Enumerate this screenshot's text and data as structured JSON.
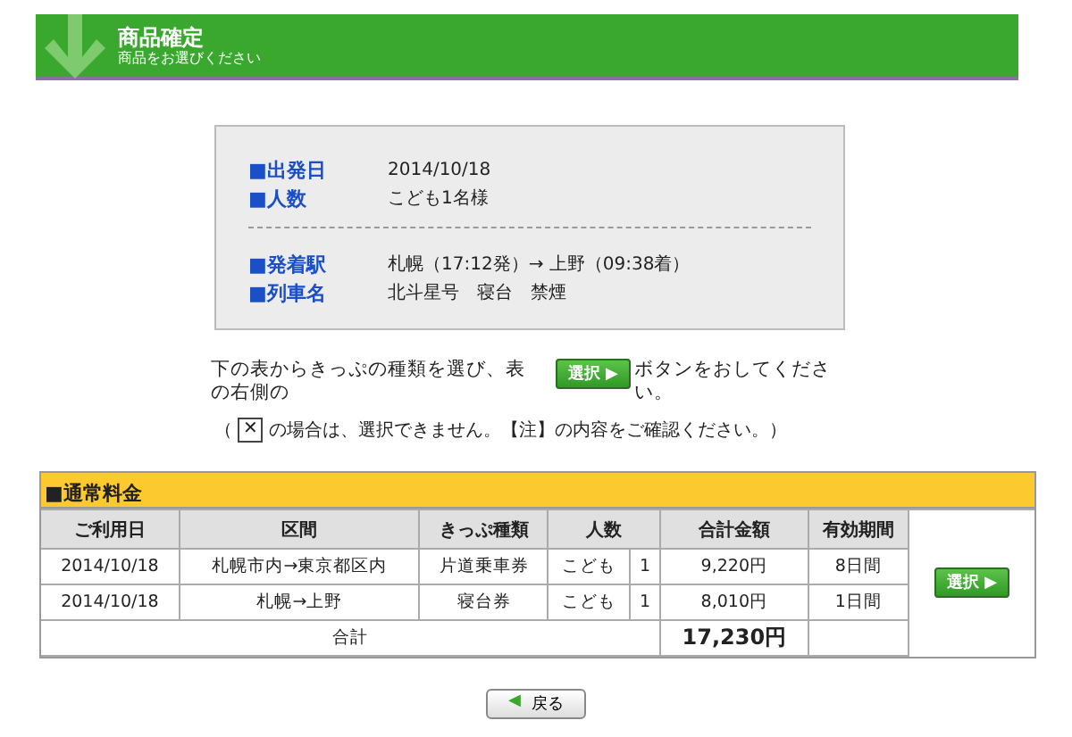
{
  "header": {
    "title": "商品確定",
    "subtitle": "商品をお選びください"
  },
  "summary": {
    "groups": [
      [
        {
          "label": "■出発日",
          "value": "2014/10/18"
        },
        {
          "label": "■人数",
          "value": "こども1名様"
        }
      ],
      [
        {
          "label": "■発着駅",
          "value": "札幌（17:12発）→ 上野（09:38着）"
        },
        {
          "label": "■列車名",
          "value": "北斗星号　寝台　禁煙"
        }
      ]
    ]
  },
  "instructions": {
    "before": "下の表からきっぷの種類を選び、表の右側の",
    "button": "選択 ▶",
    "after": "ボタンをおしてください。",
    "note_open": "（",
    "note_icon": "✕",
    "note_rest": "の場合は、選択できません。【注】の内容をご確認ください。）"
  },
  "fare_table": {
    "title": "■通常料金",
    "columns": [
      "ご利用日",
      "区間",
      "きっぷ種類",
      "人数",
      "合計金額",
      "有効期間"
    ],
    "rows": [
      {
        "date": "2014/10/18",
        "section": "札幌市内→東京都区内",
        "type": "片道乗車券",
        "passenger": "こども",
        "count": "1",
        "amount": "9,220円",
        "validity": "8日間"
      },
      {
        "date": "2014/10/18",
        "section": "札幌→上野",
        "type": "寝台券",
        "passenger": "こども",
        "count": "1",
        "amount": "8,010円",
        "validity": "1日間"
      }
    ],
    "total_label": "合計",
    "total": "17,230円",
    "select_button": "選択 ▶"
  },
  "back_button": {
    "icon": "◀",
    "label": "戻る"
  }
}
